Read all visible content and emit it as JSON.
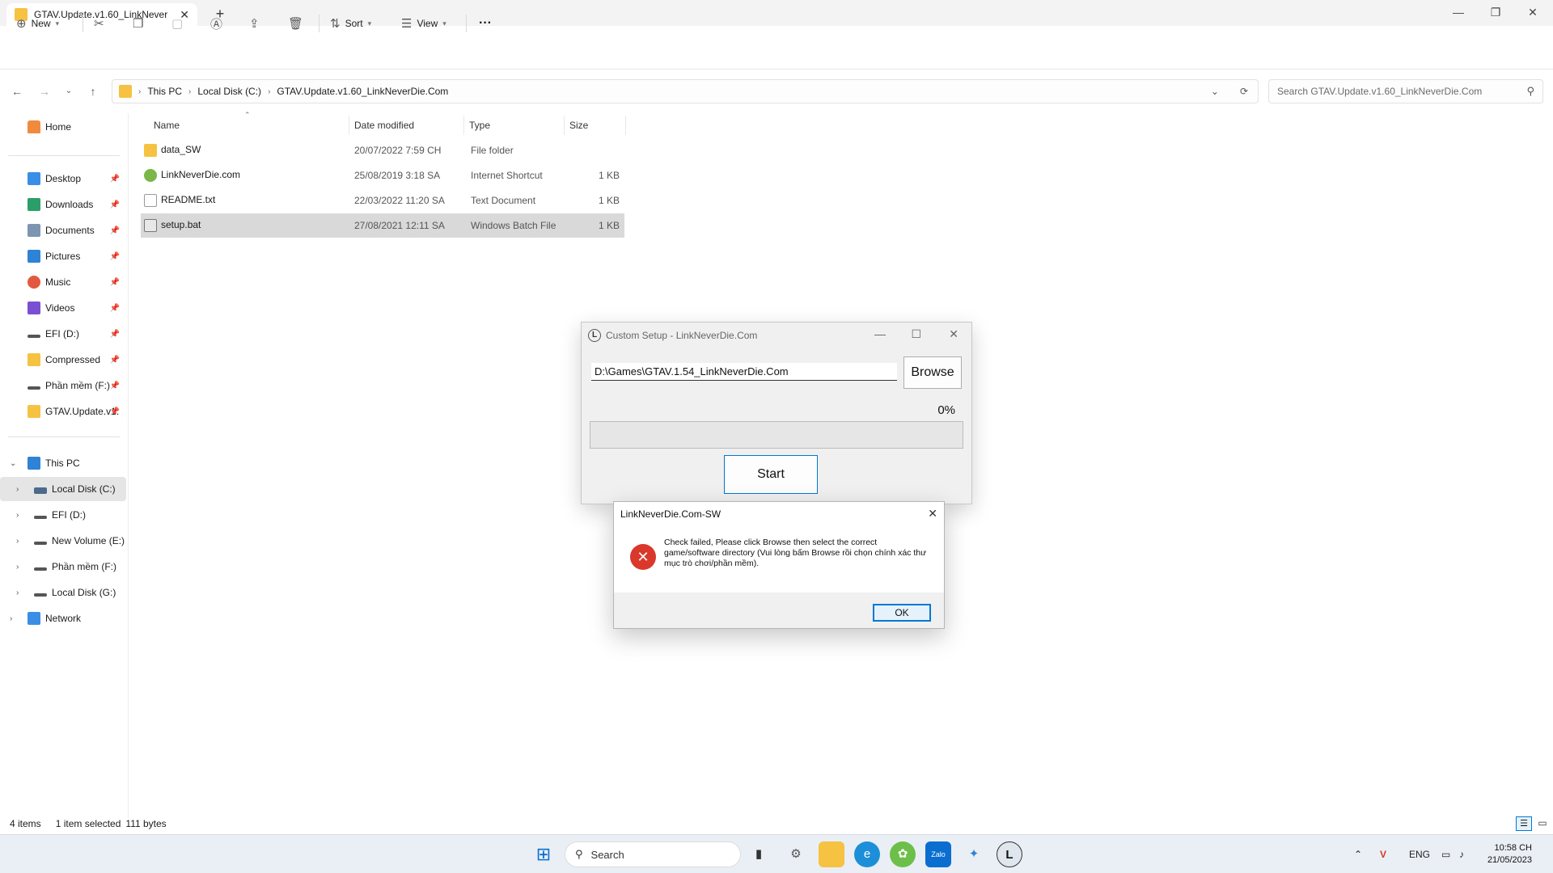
{
  "window": {
    "tab_title": "GTAV.Update.v1.60_LinkNever",
    "tab_close": "✕",
    "new_tab": "+",
    "controls": {
      "minimize": "—",
      "maximize": "❐",
      "close": "✕"
    }
  },
  "toolbar": {
    "new_label": "New",
    "sort_label": "Sort",
    "view_label": "View",
    "more_label": "···"
  },
  "address": {
    "crumbs": [
      "This PC",
      "Local Disk (C:)",
      "GTAV.Update.v1.60_LinkNeverDie.Com"
    ],
    "search_placeholder": "Search GTAV.Update.v1.60_LinkNeverDie.Com"
  },
  "nav": {
    "home": "Home",
    "quick": [
      {
        "label": "Desktop",
        "pinned": true
      },
      {
        "label": "Downloads",
        "pinned": true
      },
      {
        "label": "Documents",
        "pinned": true
      },
      {
        "label": "Pictures",
        "pinned": true
      },
      {
        "label": "Music",
        "pinned": true
      },
      {
        "label": "Videos",
        "pinned": true
      },
      {
        "label": "EFI (D:)",
        "pinned": true
      },
      {
        "label": "Compressed",
        "pinned": true
      },
      {
        "label": "Phần mềm (F:)",
        "pinned": true
      },
      {
        "label": "GTAV.Update.v1.",
        "pinned": true
      }
    ],
    "this_pc": "This PC",
    "drives": [
      "Local Disk (C:)",
      "EFI (D:)",
      "New Volume (E:)",
      "Phần mềm (F:)",
      "Local Disk (G:)"
    ],
    "network": "Network"
  },
  "files": {
    "columns": {
      "name": "Name",
      "date": "Date modified",
      "type": "Type",
      "size": "Size"
    },
    "rows": [
      {
        "name": "data_SW",
        "date": "20/07/2022 7:59 CH",
        "type": "File folder",
        "size": ""
      },
      {
        "name": "LinkNeverDie.com",
        "date": "25/08/2019 3:18 SA",
        "type": "Internet Shortcut",
        "size": "1 KB"
      },
      {
        "name": "README.txt",
        "date": "22/03/2022 11:20 SA",
        "type": "Text Document",
        "size": "1 KB"
      },
      {
        "name": "setup.bat",
        "date": "27/08/2021 12:11 SA",
        "type": "Windows Batch File",
        "size": "1 KB"
      }
    ]
  },
  "status": {
    "items": "4 items",
    "selected": "1 item selected",
    "size": "111 bytes"
  },
  "setup": {
    "title": "Custom Setup  - LinkNeverDie.Com",
    "logo": "L",
    "path": "D:\\Games\\GTAV.1.54_LinkNeverDie.Com",
    "browse": "Browse",
    "percent_label": "0%",
    "progress": 0,
    "start": "Start"
  },
  "dialog": {
    "title": "LinkNeverDie.Com-SW",
    "message": "Check failed, Please click Browse then select the correct game/software directory (Vui lòng bấm Browse rồi chọn chính xác thư mục trò chơi/phần mềm).",
    "ok": "OK",
    "icon": "error-icon"
  },
  "taskbar": {
    "search": "Search",
    "lang": "ENG",
    "time": "10:58 CH",
    "date": "21/05/2023"
  },
  "colors": {
    "accent": "#0078d4",
    "error": "#d9382a",
    "selection": "#d9d9d9"
  }
}
